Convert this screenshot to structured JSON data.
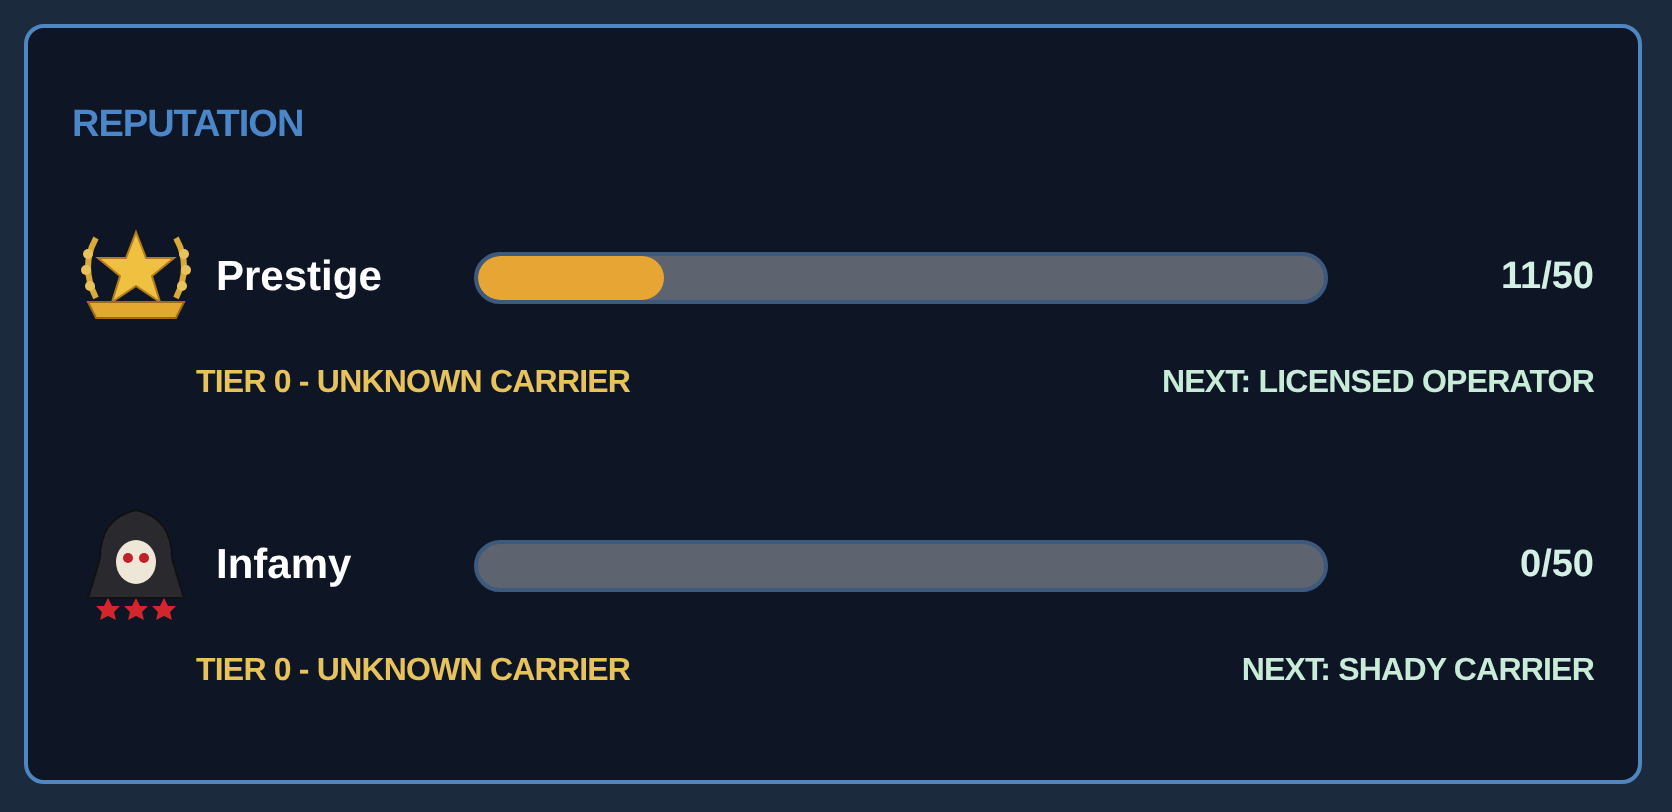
{
  "panel": {
    "title": "REPUTATION"
  },
  "tracks": [
    {
      "kind": "laurel",
      "name": "Prestige",
      "level": 0.22,
      "reading": "11/50",
      "tier": "TIER 0 - UNKNOWN CARRIER",
      "next": "NEXT: LICENSED OPERATOR"
    },
    {
      "kind": "reaper",
      "name": "Infamy",
      "level": 0,
      "reading": "0/50",
      "tier": "TIER 0 - UNKNOWN CARRIER",
      "next": "NEXT: SHADY CARRIER"
    }
  ]
}
